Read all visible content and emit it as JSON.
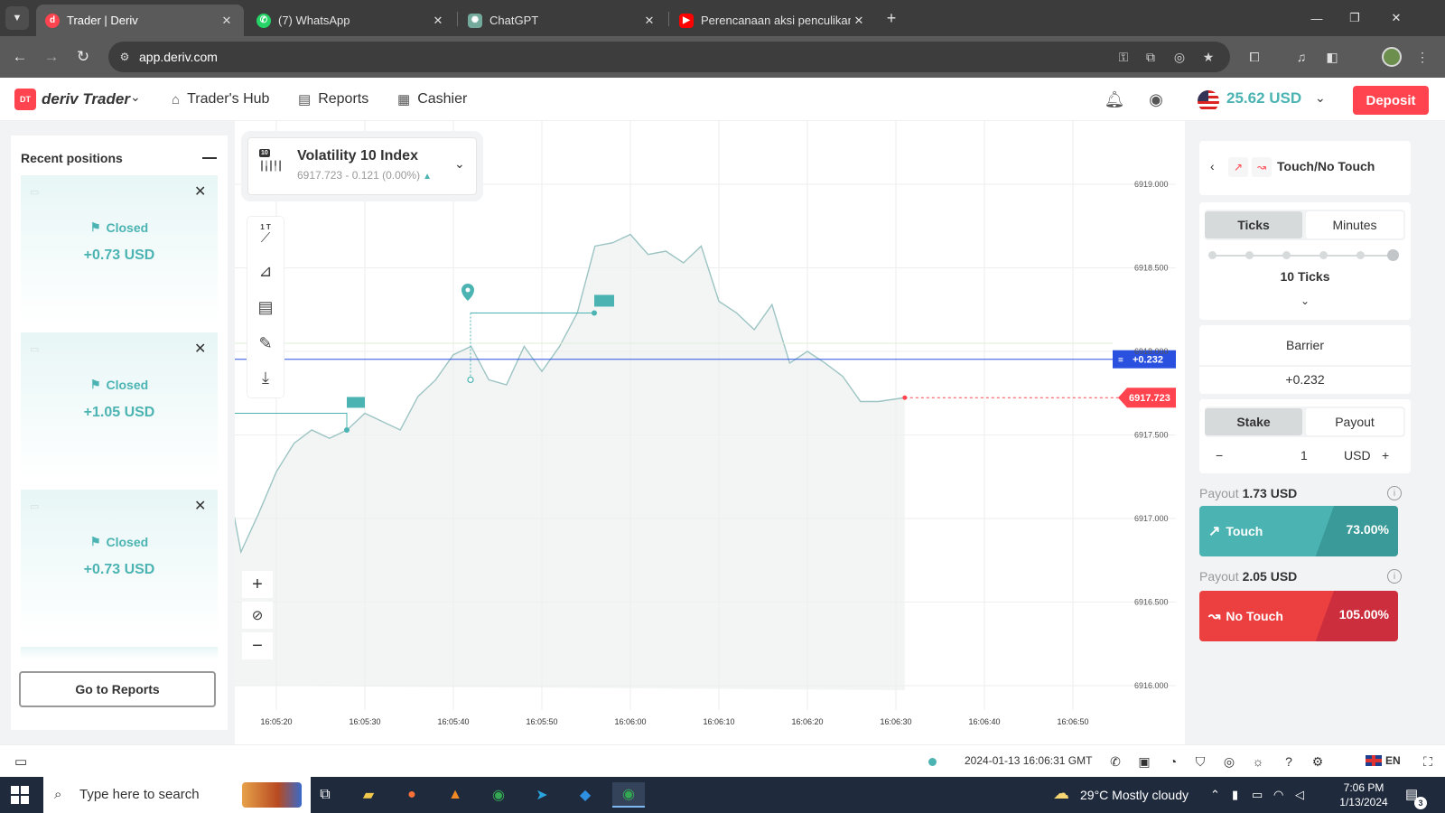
{
  "browser": {
    "tabs": [
      {
        "title": "Trader | Deriv",
        "favicon": "deriv-icon",
        "color": "#ff444f",
        "active": true
      },
      {
        "title": "(7) WhatsApp",
        "favicon": "whatsapp-icon",
        "color": "#25d366",
        "active": false
      },
      {
        "title": "ChatGPT",
        "favicon": "chatgpt-icon",
        "color": "#74aa9c",
        "active": false
      },
      {
        "title": "Perencanaan aksi penculikan ib",
        "favicon": "youtube-icon",
        "color": "#ff0000",
        "active": false
      }
    ],
    "url": "app.deriv.com"
  },
  "header": {
    "brand": "deriv Trader",
    "logo_badge": "DT",
    "nav": [
      "Trader's Hub",
      "Reports",
      "Cashier"
    ],
    "balance": "25.62 USD",
    "deposit_label": "Deposit"
  },
  "recent_positions": {
    "title": "Recent positions",
    "items": [
      {
        "status": "Closed",
        "pnl": "+0.73 USD"
      },
      {
        "status": "Closed",
        "pnl": "+1.05 USD"
      },
      {
        "status": "Closed",
        "pnl": "+0.73 USD"
      }
    ],
    "reports_button": "Go to Reports"
  },
  "market": {
    "badge": "10",
    "name": "Volatility 10 Index",
    "quote": "6917.723 - 0.121 (0.00%)",
    "tool_interval": "1 T"
  },
  "chart_data": {
    "type": "line",
    "y_ticks": [
      "6919.000",
      "6918.500",
      "6918.000",
      "6917.500",
      "6917.000",
      "6916.500",
      "6916.000"
    ],
    "x_ticks": [
      "16:05:20",
      "16:05:30",
      "16:05:40",
      "16:05:50",
      "16:06:00",
      "16:06:10",
      "16:06:20",
      "16:06:30",
      "16:06:40",
      "16:06:50"
    ],
    "ylim": [
      6916.0,
      6919.0
    ],
    "barrier_label": "+0.232",
    "current_price_label": "6917.723",
    "series": [
      {
        "points": [
          [
            "16:05:15",
            6917.08
          ],
          [
            "16:05:16",
            6916.8
          ],
          [
            "16:05:18",
            6917.03
          ],
          [
            "16:05:20",
            6917.28
          ],
          [
            "16:05:22",
            6917.45
          ],
          [
            "16:05:24",
            6917.53
          ],
          [
            "16:05:26",
            6917.48
          ],
          [
            "16:05:28",
            6917.53
          ],
          [
            "16:05:30",
            6917.63
          ],
          [
            "16:05:32",
            6917.58
          ],
          [
            "16:05:34",
            6917.53
          ],
          [
            "16:05:36",
            6917.73
          ],
          [
            "16:05:38",
            6917.83
          ],
          [
            "16:05:40",
            6917.98
          ],
          [
            "16:05:42",
            6918.03
          ],
          [
            "16:05:44",
            6917.83
          ],
          [
            "16:05:46",
            6917.8
          ],
          [
            "16:05:48",
            6918.03
          ],
          [
            "16:05:50",
            6917.88
          ],
          [
            "16:05:52",
            6918.03
          ],
          [
            "16:05:54",
            6918.23
          ],
          [
            "16:05:56",
            6918.63
          ],
          [
            "16:05:58",
            6918.65
          ],
          [
            "16:06:00",
            6918.7
          ],
          [
            "16:06:02",
            6918.58
          ],
          [
            "16:06:04",
            6918.6
          ],
          [
            "16:06:06",
            6918.53
          ],
          [
            "16:06:08",
            6918.63
          ],
          [
            "16:06:10",
            6918.3
          ],
          [
            "16:06:12",
            6918.23
          ],
          [
            "16:06:14",
            6918.13
          ],
          [
            "16:06:16",
            6918.28
          ],
          [
            "16:06:18",
            6917.93
          ],
          [
            "16:06:20",
            6918.0
          ],
          [
            "16:06:22",
            6917.93
          ],
          [
            "16:06:24",
            6917.85
          ],
          [
            "16:06:26",
            6917.7
          ],
          [
            "16:06:28",
            6917.7
          ],
          [
            "16:06:31",
            6917.723
          ]
        ]
      }
    ]
  },
  "trade_panel": {
    "contract_type": "Touch/No Touch",
    "duration_tabs": [
      "Ticks",
      "Minutes"
    ],
    "duration_value": "10 Ticks",
    "barrier_label": "Barrier",
    "barrier_value": "+0.232",
    "stake_tabs": [
      "Stake",
      "Payout"
    ],
    "stake_minus": "−",
    "stake_value": "1",
    "stake_currency": "USD",
    "stake_plus": "+",
    "touch": {
      "payout_label": "Payout",
      "payout": "1.73 USD",
      "button": "Touch",
      "percent": "73.00%"
    },
    "no_touch": {
      "payout_label": "Payout",
      "payout": "2.05 USD",
      "button": "No Touch",
      "percent": "105.00%"
    }
  },
  "footer": {
    "server_time": "2024-01-13 16:06:31 GMT",
    "language": "EN"
  },
  "taskbar": {
    "search_placeholder": "Type here to search",
    "weather": "29°C  Mostly cloudy",
    "time": "7:06 PM",
    "date": "1/13/2024",
    "notifications": "3"
  },
  "colors": {
    "brand_red": "#ff444f",
    "teal": "#4bb4b3",
    "barrier_blue": "#2a50e0"
  }
}
